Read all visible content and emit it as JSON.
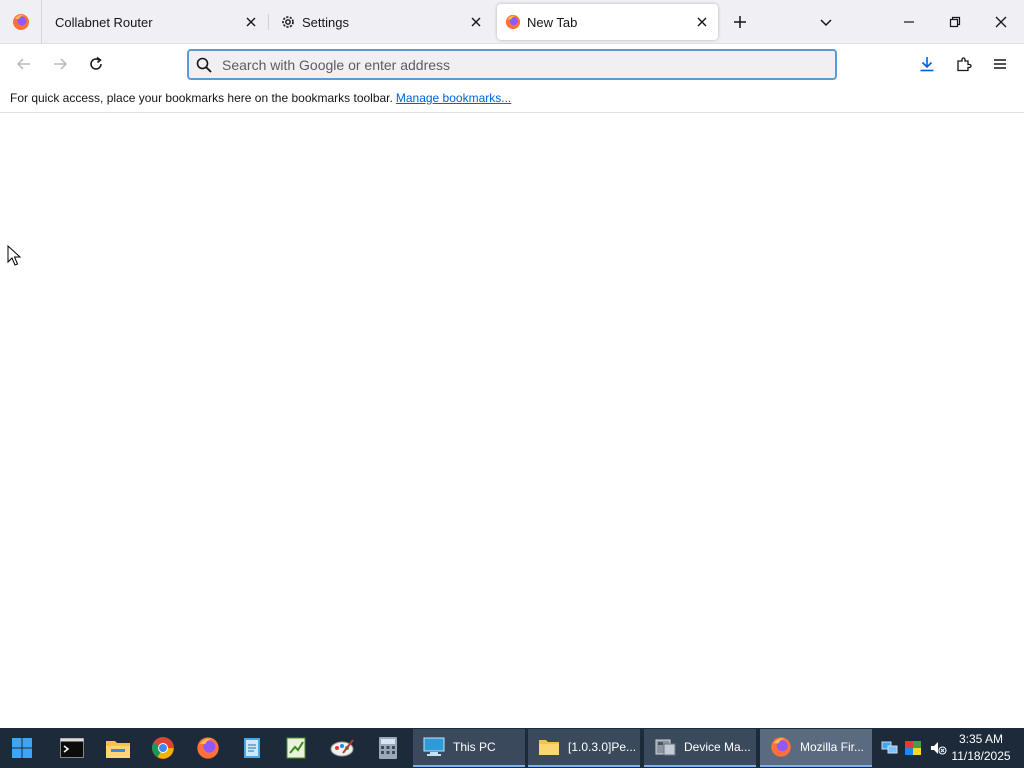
{
  "browser": {
    "tabs": [
      {
        "label": "Collabnet Router",
        "icon": "firefox-icon"
      },
      {
        "label": "Settings",
        "icon": "gear-icon"
      },
      {
        "label": "New Tab",
        "icon": "firefox-icon",
        "active": true
      }
    ],
    "urlbar": {
      "placeholder": "Search with Google or enter address",
      "value": ""
    },
    "bookmarks_bar": {
      "message": "For quick access, place your bookmarks here on the bookmarks toolbar.",
      "link": "Manage bookmarks..."
    }
  },
  "taskbar": {
    "pinned": [
      "windows-start-icon",
      "terminal-icon",
      "file-explorer-icon",
      "chrome-icon",
      "firefox-icon",
      "notepad-icon",
      "spreadsheet-icon",
      "paint-icon",
      "calculator-icon"
    ],
    "tasks": [
      {
        "label": "This PC",
        "icon": "computer-icon"
      },
      {
        "label": "[1.0.3.0]Pe...",
        "icon": "folder-icon"
      },
      {
        "label": "Device Ma...",
        "icon": "device-manager-icon"
      },
      {
        "label": "Mozilla Fir...",
        "icon": "firefox-icon",
        "active": true
      }
    ],
    "clock": {
      "time": "3:35 AM",
      "date": "11/18/2025"
    }
  },
  "colors": {
    "accent": "#5b9bd5",
    "link": "#0061e0",
    "taskbar": "#1d2a3a"
  }
}
